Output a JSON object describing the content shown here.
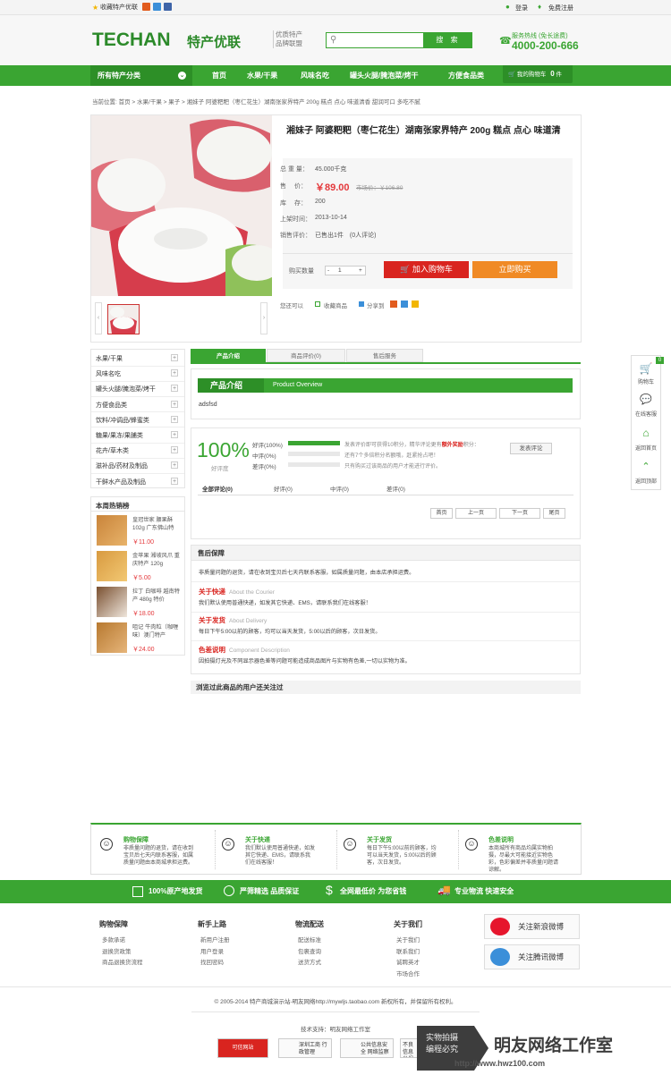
{
  "topbar": {
    "favorite": "收藏特产优联",
    "login": "登录",
    "register": "免费注册"
  },
  "header": {
    "logo": "TECHAN",
    "logo_cn": "特产优联",
    "slogan1": "优质特产",
    "slogan2": "品牌联盟",
    "search_button": "搜 索",
    "hotline_label": "服务热线 (免长途费)",
    "hotline": "4000-200-666"
  },
  "nav": {
    "all": "所有特产分类",
    "items": [
      "首页",
      "水果/干果",
      "风味名吃",
      "罐头火腿/腌泡菜/烤干",
      "方便食品类"
    ],
    "cart": "我的购物车",
    "cart_count": "0",
    "cart_unit": "件"
  },
  "breadcrumb": "当前位置: 首页 > 水果/干果 > 果子 > 湘妹子 阿婆粑粑（枣仁花生）湖南张家界特产 200g 糕点 点心 味道清香 甜润可口 多吃不腻",
  "product": {
    "title": "湘妹子 阿婆粑粑（枣仁花生）湖南张家界特产 200g 糕点 点心 味道清",
    "weight_label": "总 重 量：",
    "weight": "45.000千克",
    "price_label": "售　 价：",
    "price": "￥89.00",
    "old_price": "市场价：￥106.80",
    "stock_label": "库　 存：",
    "stock": "200",
    "date_label": "上架时间：",
    "date": "2013-10-14",
    "sales_label": "销售评价：",
    "sales": "已售出1件　(0人评论)",
    "qty_label": "购买数量",
    "qty_minus": "-",
    "qty": "1",
    "qty_plus": "+",
    "add_cart": "加入购物车",
    "buy_now": "立即购买",
    "also": "您还可以",
    "collect": "收藏商品",
    "share": "分享到"
  },
  "categories": [
    "水果/干果",
    "风味名吃",
    "罐头火腿/腌泡菜/烤干",
    "方便食品类",
    "饮料/冲调品/蜂蜜类",
    "糖果/果冻/果脯类",
    "花卉/草木类",
    "滋补品/药材及制品",
    "干鲜水产品及制品"
  ],
  "hot": {
    "title": "本周热销榜",
    "items": [
      {
        "name": "皇冠世家 腰果酥 102g 广东佛山特",
        "price": "￥11.00"
      },
      {
        "name": "金苹果 湘坡风爪 重庆特产 120g",
        "price": "￥5.00"
      },
      {
        "name": "拉丁 白咖啡 越南特产 480g 特价",
        "price": "￥18.00"
      },
      {
        "name": "咀记 牛肉粒（咖喱味）澳门特产",
        "price": "￥24.00"
      }
    ]
  },
  "tabs": [
    "产品介绍",
    "商品评价(0)",
    "售后服务"
  ],
  "intro": {
    "title": "产品介绍",
    "en": "Product Overview",
    "text": "adsfsd"
  },
  "review": {
    "percent": "100%",
    "percent_label": "好评度",
    "rows": [
      {
        "label": "好评(100%)",
        "pct": 100
      },
      {
        "label": "中评(0%)",
        "pct": 0
      },
      {
        "label": "差评(0%)",
        "pct": 0
      }
    ],
    "note1": "发表评价即可获得10积分，精华评论更有",
    "note1_red": "额外奖励",
    "note1_end": "积分：",
    "note2": "还有7个多倍积分名额哦，赶紧抢占吧！",
    "note3": "只有购买过该商品的用户才能进行评价。",
    "button": "发表评论",
    "tabs": [
      "全部评论(0)",
      "好评(0)",
      "中评(0)",
      "差评(0)"
    ],
    "pager": [
      "首页",
      "上一页",
      "下一页",
      "尾页"
    ]
  },
  "service": {
    "head": "售后保障",
    "intro": "非质量问题的退货，请在收到宝贝后七天内联系客服，如属质量问题，由本店承担运费。",
    "items": [
      {
        "t": "关于快递",
        "en": "About the Courier",
        "d": "我们默认使用普通快递，如发其它快递、EMS，请联系我们在线客服！"
      },
      {
        "t": "关于发货",
        "en": "About Delivery",
        "d": "每日下午5:00以前的顾客，均可以当天发货，5:00以后的顾客，次日发货。"
      },
      {
        "t": "色差说明",
        "en": "Component Description",
        "d": "因拍摄灯光及不同显示器色差等问题可能造成商品图片与实物有色差,一切以实物为准。"
      }
    ]
  },
  "viewed": "浏览过此商品的用户还关注过",
  "sidebar": [
    "购物车",
    "在线客服",
    "返回首页",
    "返回顶部"
  ],
  "sidebar_cart_count": "0",
  "guarantee": [
    {
      "t": "购物保障",
      "d": "非质量问题的退货，请在收到宝贝后七天内联系客服，如属质量问题由本商城承担运费。"
    },
    {
      "t": "关于快递",
      "d": "我们默认使用普通快递，如发其它快递、EMS，请联系我们在线客服！"
    },
    {
      "t": "关于发货",
      "d": "每日下午5:00以前的顾客，均可以当天发货，5:00以后的顾客，次日发货。"
    },
    {
      "t": "色差说明",
      "d": "本商城所有商品均属实物拍摄，尽最大可能接近实物色彩，色彩偏差并非质量问题请谅解。"
    }
  ],
  "band": [
    "100%原产地发货",
    "严筛精选 品质保证",
    "全网最低价 为您省钱",
    "专业物流 快速安全"
  ],
  "footer": {
    "cols": [
      {
        "h": "购物保障",
        "l": [
          "多款承诺",
          "退换货政策",
          "商品退换货流程"
        ]
      },
      {
        "h": "新手上路",
        "l": [
          "新用户注册",
          "用户登录",
          "找回密码"
        ]
      },
      {
        "h": "物流配送",
        "l": [
          "配送标准",
          "包裹查询",
          "送货方式"
        ]
      },
      {
        "h": "关于我们",
        "l": [
          "关于我们",
          "联系我们",
          "诚聘英才",
          "市场合作"
        ]
      }
    ],
    "weibo1": "关注新浪微博",
    "weibo2": "关注腾讯微博",
    "copyright": "© 2005-2014 特产商城演示站-明友网络http://mywljs.taobao.com 新权所有，并保留所有权利。",
    "tech": "技术支持：明友网络工作室",
    "badges": [
      "可信网站",
      "深圳工商 行政管理",
      "公共信息安全 网络监察",
      "不良信息 举报中心"
    ]
  },
  "watermark": {
    "line1": "实物拍摄",
    "line2": "编程必究",
    "brand": "明友网络工作室",
    "url": "http://www.hwz100.com"
  }
}
